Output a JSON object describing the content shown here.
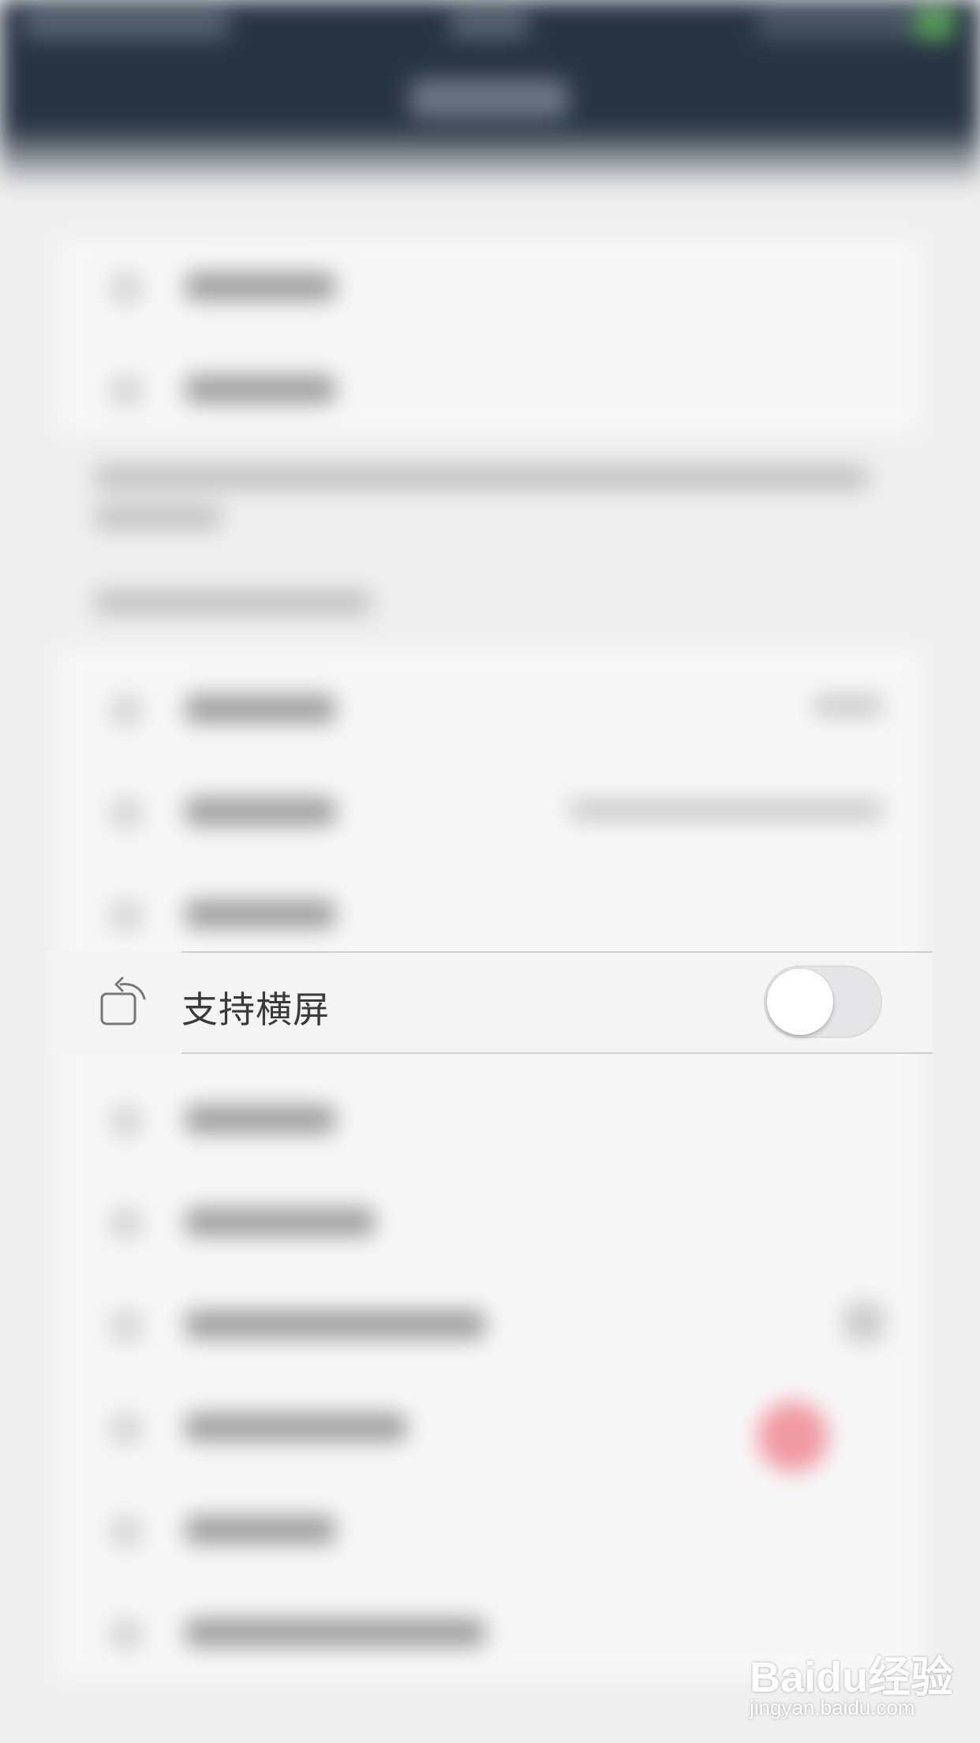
{
  "settings": {
    "landscape_row": {
      "label": "支持横屏",
      "icon": "rotate-screen-icon",
      "toggle_on": false
    }
  },
  "watermark": {
    "logo": "Baidu经验",
    "url": "jingyan.baidu.com"
  },
  "colors": {
    "header_bg": "#283444",
    "page_bg": "#efefef",
    "toggle_off_track": "#e5e5e7",
    "badge_red": "#ef8e99"
  }
}
